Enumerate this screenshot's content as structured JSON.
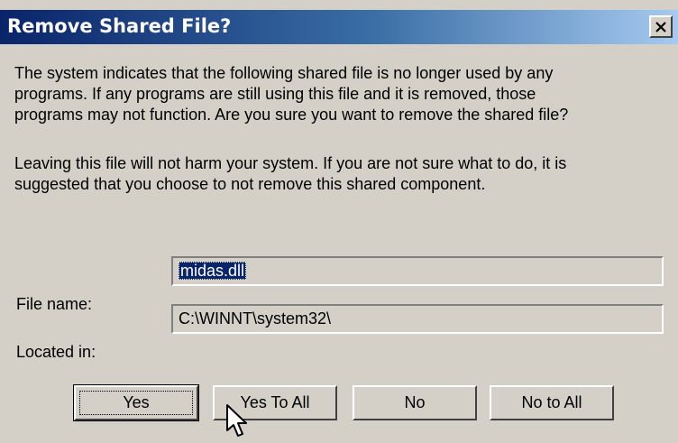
{
  "dialog": {
    "title": "Remove Shared File?",
    "close_icon": "close-icon"
  },
  "message": {
    "paragraph1_line1": "The system indicates that the following shared file is no longer used by any",
    "paragraph1_line2": "programs.  If any programs are still using this file and it is removed, those",
    "paragraph1_line3": "programs may not function.  Are you sure you want to remove the shared file?",
    "paragraph2_line1": "Leaving this file will not harm your system.  If you are not sure what to do, it is",
    "paragraph2_line2": "suggested that you choose to not remove this shared component."
  },
  "fields": {
    "file_name_label": "File name:",
    "file_name_value": "midas.dll",
    "located_in_label": "Located in:",
    "located_in_value": "C:\\WINNT\\system32\\"
  },
  "buttons": {
    "yes": "Yes",
    "yes_to_all": "Yes To All",
    "no": "No",
    "no_to_all": "No to All"
  },
  "colors": {
    "title_gradient_start": "#0a246a",
    "title_gradient_end": "#a6caf0",
    "face": "#d4d0c8",
    "selection": "#0a246a"
  },
  "icons": {
    "cursor": "mouse-pointer-icon"
  }
}
